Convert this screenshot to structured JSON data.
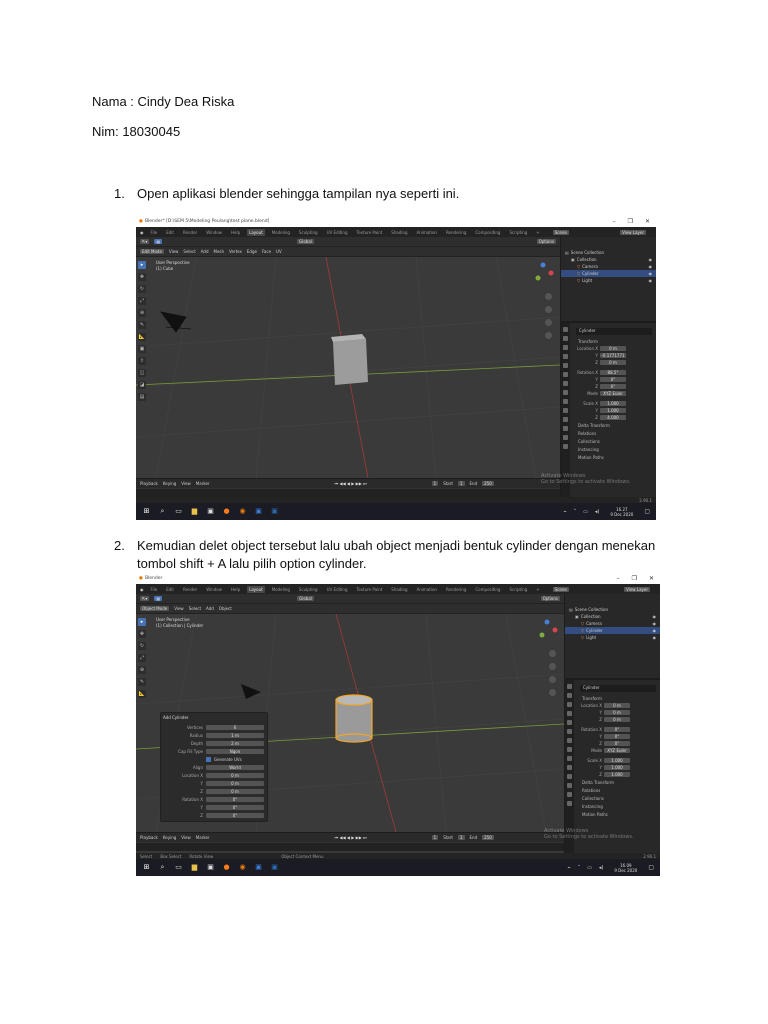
{
  "doc": {
    "name_line": "Nama : Cindy Dea Riska",
    "nim_line": "Nim: 18030045",
    "steps": [
      {
        "number": "1.",
        "text": "Open aplikasi blender sehingga tampilan nya seperti ini."
      },
      {
        "number": "2.",
        "text_line1": "Kemudian delet object tersebut lalu ubah object menjadi bentuk cylinder dengan menekan",
        "text_line2": "tombol shift + A lalu pilih option cylinder."
      }
    ]
  },
  "blender": {
    "menu": [
      "File",
      "Edit",
      "Render",
      "Window",
      "Help"
    ],
    "tabs": [
      "Layout",
      "Modeling",
      "Sculpting",
      "UV Editing",
      "Texture Paint",
      "Shading",
      "Animation",
      "Rendering",
      "Compositing",
      "Scripting",
      "+"
    ],
    "scene": "Scene",
    "view_layer": "View Layer",
    "orientation": "Global",
    "options": "Options",
    "outliner": [
      "Scene Collection",
      "Collection",
      "Camera",
      "Cylinder",
      "Light"
    ],
    "transform": "Transform",
    "location_labels": [
      "Location X",
      "Y",
      "Z"
    ],
    "rotation_labels": [
      "Rotation X",
      "Y",
      "Z"
    ],
    "scale_labels": [
      "Scale X",
      "Y",
      "Z"
    ],
    "mode_label": "Mode",
    "mode_value": "XYZ Euler",
    "sections": [
      "Delta Transform",
      "Relations",
      "Collections",
      "Instancing",
      "Motion Paths"
    ],
    "timeline_menu": [
      "Playback",
      "Keying",
      "View",
      "Marker"
    ],
    "start_label": "Start",
    "start": "1",
    "end_label": "End",
    "end": "250",
    "current_frame": "1",
    "activate_windows": "Activate Windows",
    "activate_hint": "Go to Settings to activate Windows.",
    "accent": "#4772b3",
    "selection_color": "#f5a623"
  },
  "shot1": {
    "title": "Blender* [D:\\SEM 5\\Modeling Peulang\\test plane.blend]",
    "mode": "Edit Mode",
    "header_menu": [
      "View",
      "Select",
      "Add",
      "Mesh",
      "Vertex",
      "Edge",
      "Face",
      "UV"
    ],
    "vp_line1": "User Perspective",
    "vp_line2": "(1) Cube",
    "object_name": "Cylinder",
    "location": [
      "0 m",
      "-0.1771771",
      "0 m"
    ],
    "rotation": [
      "88.5°",
      "0°",
      "0°"
    ],
    "scale": [
      "1.000",
      "1.000",
      "4.000"
    ],
    "clock_time": "16.27",
    "clock_date": "9 Dec 2020",
    "version": "2.90.1"
  },
  "shot2": {
    "title": "Blender",
    "mode": "Object Mode",
    "header_menu": [
      "View",
      "Select",
      "Add",
      "Object"
    ],
    "vp_line1": "User Perspective",
    "vp_line2": "(1) Collection | Cylinder",
    "object_name": "Cylinder",
    "location": [
      "0 m",
      "0 m",
      "0 m"
    ],
    "rotation": [
      "0°",
      "0°",
      "0°"
    ],
    "scale": [
      "1.000",
      "1.000",
      "1.000"
    ],
    "status": [
      "Select",
      "Box Select",
      "Rotate View",
      "Object Context Menu"
    ],
    "clock_time": "16.09",
    "clock_date": "9 Dec 2020",
    "version": "2.90.1",
    "op_panel": {
      "title": "Add Cylinder",
      "rows": [
        {
          "label": "Vertices",
          "value": "6"
        },
        {
          "label": "Radius",
          "value": "1 m"
        },
        {
          "label": "Depth",
          "value": "2 m"
        },
        {
          "label": "Cap Fill Type",
          "value": "Ngon"
        },
        {
          "label": "",
          "value": "Generate UVs"
        },
        {
          "label": "Align",
          "value": "World"
        },
        {
          "label": "Location X",
          "value": "0 m"
        },
        {
          "label": "Y",
          "value": "0 m"
        },
        {
          "label": "Z",
          "value": "0 m"
        },
        {
          "label": "Rotation X",
          "value": "0°"
        },
        {
          "label": "Y",
          "value": "0°"
        },
        {
          "label": "Z",
          "value": "0°"
        }
      ]
    }
  }
}
